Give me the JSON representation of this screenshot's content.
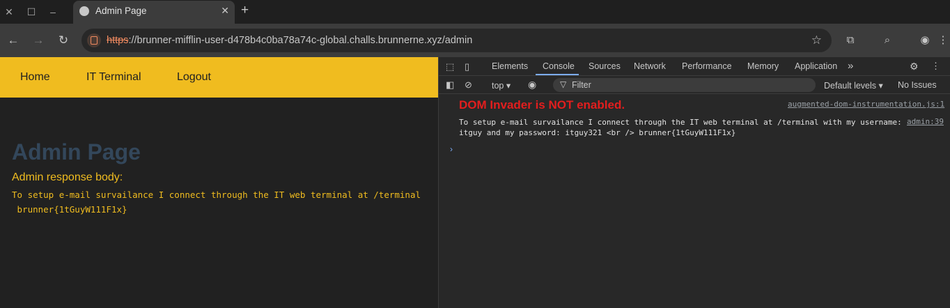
{
  "browser": {
    "tab_title": "Admin Page",
    "url_scheme": "https",
    "url_rest": "://brunner-mifflin-user-d478b4c0ba78a74c-global.challs.brunnerne.xyz/admin"
  },
  "page": {
    "nav": [
      "Home",
      "IT Terminal",
      "Logout"
    ],
    "heading": "Admin Page",
    "response_label": "Admin response body:",
    "response_line1": "To setup e-mail survailance I connect through the IT web terminal at /terminal",
    "response_line2": " brunner{1tGuyW111F1x}"
  },
  "devtools": {
    "tabs": [
      "Elements",
      "Console",
      "Sources",
      "Network",
      "Performance",
      "Memory",
      "Application"
    ],
    "active_tab": "Console",
    "context": "top",
    "filter_placeholder": "Filter",
    "levels": "Default levels",
    "issues": "No Issues",
    "messages": [
      {
        "text": "DOM Invader is NOT enabled.",
        "source": "augmented-dom-instrumentation.js:1",
        "color": "#e21e1e"
      },
      {
        "text": "To setup e-mail survailance I connect through the IT web terminal at /terminal with my username:\nitguy and my password: itguy321 <br /> brunner{1tGuyW111F1x}",
        "source": "admin:39"
      }
    ]
  },
  "colors": {
    "nav_bar": "#f0bc1f",
    "heading": "#33475b",
    "accent_text": "#f0bc1f"
  }
}
